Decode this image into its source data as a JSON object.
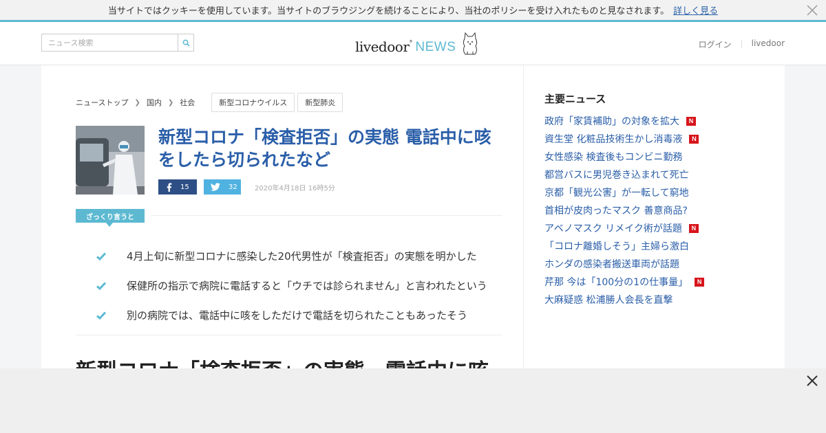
{
  "cookie": {
    "message": "当サイトではクッキーを使用しています。当サイトのブラウジングを続けることにより、当社のポリシーを受け入れたものと見なされます。",
    "more_link": "詳しく見る"
  },
  "header": {
    "search_placeholder": "ニュース検索",
    "logo_livedoor": "livedoor",
    "logo_news": "NEWS",
    "login": "ログイン",
    "livedoor_link": "livedoor"
  },
  "breadcrumb": [
    "ニューストップ",
    "国内",
    "社会"
  ],
  "tags": [
    "新型コロナウイルス",
    "新型肺炎"
  ],
  "article": {
    "headline": "新型コロナ「検査拒否」の実態 電話中に咳をしたら切られたなど",
    "fb_count": "15",
    "tw_count": "32",
    "date": "2020年4月18日 16時5分",
    "summary_label": "ざっくり言うと",
    "summary": [
      "4月上旬に新型コロナに感染した20代男性が「検査拒否」の実態を明かした",
      "保健所の指示で病院に電話すると「ウチでは診られません」と言われたという",
      "別の病院では、電話中に咳をしただけで電話を切られたこともあったそう"
    ],
    "body_title": "新型コロナ「検査拒否」の実態　電話中に咳"
  },
  "sidebar": {
    "title": "主要ニュース",
    "items": [
      {
        "text": "政府「家賃補助」の対象を拡大",
        "new": true
      },
      {
        "text": "資生堂 化粧品技術生かし消毒液",
        "new": true
      },
      {
        "text": "女性感染 検査後もコンビニ勤務",
        "new": false
      },
      {
        "text": "都営バスに男児巻き込まれて死亡",
        "new": false
      },
      {
        "text": "京都「観光公害」が一転して窮地",
        "new": false
      },
      {
        "text": "首相が皮肉ったマスク 善意商品?",
        "new": false
      },
      {
        "text": "アベノマスク リメイク術が話題",
        "new": true
      },
      {
        "text": "「コロナ離婚しそう」主婦ら激白",
        "new": false
      },
      {
        "text": "ホンダの感染者搬送車両が話題",
        "new": false
      },
      {
        "text": "芹那 今は「100分の1の仕事量」",
        "new": true
      },
      {
        "text": "大麻疑惑 松浦勝人会長を直撃",
        "new": false
      }
    ],
    "new_badge": "N"
  },
  "colors": {
    "accent": "#5cb9d1",
    "link": "#2a5ea8",
    "facebook": "#2e4f86",
    "twitter": "#50b2e0",
    "new_badge": "#d7141a"
  }
}
